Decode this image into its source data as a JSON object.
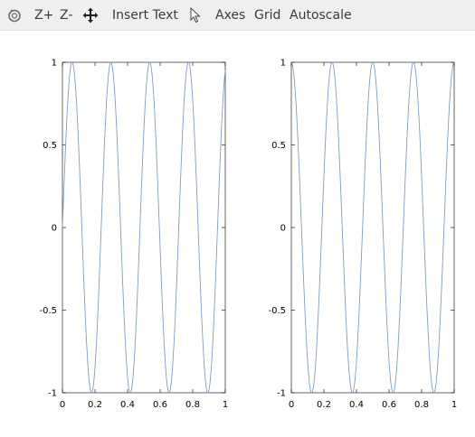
{
  "toolbar": {
    "icons": [
      "rotate-icon",
      "pan-icon",
      "select-pointer-icon"
    ],
    "zoom_in_label": "Z+",
    "zoom_out_label": "Z-",
    "insert_text_label": "Insert Text",
    "axes_label": "Axes",
    "grid_label": "Grid",
    "autoscale_label": "Autoscale"
  },
  "colors": {
    "line": "#7d9cc9",
    "axes": "#000000",
    "toolbar_bg": "#efefef"
  },
  "chart_data": [
    {
      "type": "line",
      "title": "",
      "xlabel": "",
      "ylabel": "",
      "xlim": [
        0,
        1
      ],
      "ylim": [
        -1,
        1
      ],
      "xticks": [
        "0",
        "0.2",
        "0.4",
        "0.6",
        "0.8",
        "1"
      ],
      "yticks": [
        "-1",
        "-0.5",
        "0",
        "0.5",
        "1"
      ],
      "grid": false,
      "function": "y = sin(2*pi*4.2*x)",
      "frequency": 4.2,
      "phase": 0,
      "series": [
        {
          "values_description_free": true
        }
      ]
    },
    {
      "type": "line",
      "title": "",
      "xlabel": "",
      "ylabel": "",
      "xlim": [
        0,
        1
      ],
      "ylim": [
        -1,
        1
      ],
      "xticks": [
        "0",
        "0.2",
        "0.4",
        "0.6",
        "0.8",
        "1"
      ],
      "yticks": [
        "-1",
        "-0.5",
        "0",
        "0.5",
        "1"
      ],
      "grid": false,
      "function": "y = cos(2*pi*4*x)",
      "frequency": 4,
      "phase": 1.5708,
      "series": [
        {
          "values_description_free": true
        }
      ]
    }
  ]
}
